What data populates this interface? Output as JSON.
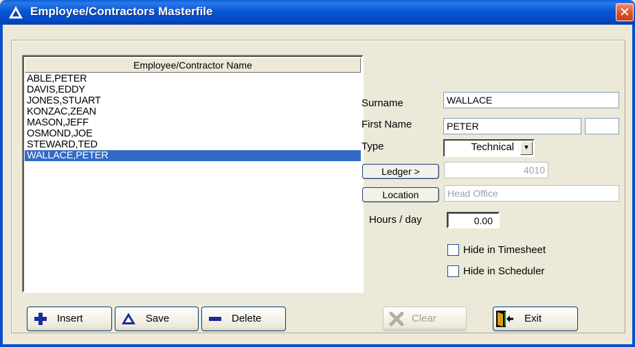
{
  "window": {
    "title": "Employee/Contractors Masterfile",
    "close_symbol": "✕"
  },
  "list": {
    "header": "Employee/Contractor Name",
    "items": [
      "ABLE,PETER",
      "DAVIS,EDDY",
      "JONES,STUART",
      "KONZAC,ZEAN",
      "MASON,JEFF",
      "OSMOND,JOE",
      "STEWARD,TED",
      "WALLACE,PETER"
    ],
    "selected_item": "WALLACE,PETER"
  },
  "form": {
    "surname_label": "Surname",
    "surname_value": "WALLACE",
    "first_name_label": "First Name",
    "first_name_value": "PETER",
    "initial_value": "",
    "type_label": "Type",
    "type_value": "Technical",
    "ledger_button": "Ledger >",
    "ledger_value": "4010",
    "location_button": "Location",
    "location_value": "Head Office",
    "hours_label": "Hours / day",
    "hours_value": "0.00",
    "hide_timesheet_label": "Hide in Timesheet",
    "hide_timesheet_checked": false,
    "hide_scheduler_label": "Hide in Scheduler",
    "hide_scheduler_checked": false
  },
  "buttons": {
    "insert": "Insert",
    "save": "Save",
    "delete": "Delete",
    "clear": "Clear",
    "exit": "Exit"
  },
  "icons": {
    "title": "triangle-icon",
    "insert": "plus-icon",
    "save": "triangle-icon",
    "delete": "minus-icon",
    "clear": "x-icon",
    "exit": "door-exit-icon",
    "combo": "chevron-down-icon"
  },
  "colors": {
    "titlebar": "#0348c5",
    "selection": "#316ac5",
    "icon_blue": "#1a2b9a"
  }
}
